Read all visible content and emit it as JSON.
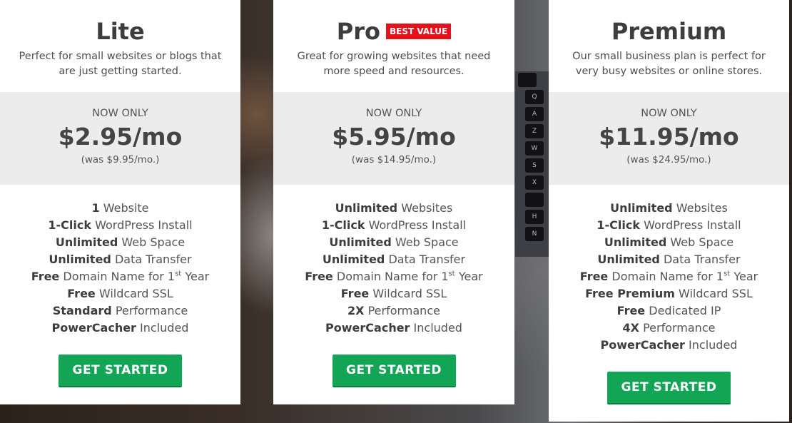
{
  "background": {
    "keyboard_keys": [
      "",
      "Q",
      "A",
      "Z",
      "W",
      "S",
      "X",
      "",
      "H",
      "N"
    ]
  },
  "colors": {
    "cta_green": "#13a556",
    "badge_red": "#e5101a",
    "price_band_gray": "#ececec"
  },
  "plans": [
    {
      "name": "Lite",
      "badge": "",
      "description": "Perfect for small websites or blogs that are just getting started.",
      "now_only": "NOW ONLY",
      "price": "$2.95/mo",
      "was": "(was $9.95/mo.)",
      "features": [
        {
          "bold": "1",
          "text": " Website"
        },
        {
          "bold": "1-Click",
          "text": " WordPress Install"
        },
        {
          "bold": "Unlimited",
          "text": " Web Space"
        },
        {
          "bold": "Unlimited",
          "text": " Data Transfer"
        },
        {
          "bold": "Free",
          "text": " Domain Name for 1",
          "sup": "st",
          "after": " Year"
        },
        {
          "bold": "Free",
          "text": " Wildcard SSL"
        },
        {
          "bold": "Standard",
          "text": " Performance"
        },
        {
          "bold": "PowerCacher",
          "text": " Included"
        }
      ],
      "cta": "GET STARTED"
    },
    {
      "name": "Pro",
      "badge": "BEST VALUE",
      "description": "Great for growing websites that need more speed and resources.",
      "now_only": "NOW ONLY",
      "price": "$5.95/mo",
      "was": "(was $14.95/mo.)",
      "features": [
        {
          "bold": "Unlimited",
          "text": " Websites"
        },
        {
          "bold": "1-Click",
          "text": " WordPress Install"
        },
        {
          "bold": "Unlimited",
          "text": " Web Space"
        },
        {
          "bold": "Unlimited",
          "text": " Data Transfer"
        },
        {
          "bold": "Free",
          "text": " Domain Name for 1",
          "sup": "st",
          "after": " Year"
        },
        {
          "bold": "Free",
          "text": " Wildcard SSL"
        },
        {
          "bold": "2X",
          "text": " Performance"
        },
        {
          "bold": "PowerCacher",
          "text": " Included"
        }
      ],
      "cta": "GET STARTED"
    },
    {
      "name": "Premium",
      "badge": "",
      "description": "Our small business plan is perfect for very busy websites or online stores.",
      "now_only": "NOW ONLY",
      "price": "$11.95/mo",
      "was": "(was $24.95/mo.)",
      "features": [
        {
          "bold": "Unlimited",
          "text": " Websites"
        },
        {
          "bold": "1-Click",
          "text": " WordPress Install"
        },
        {
          "bold": "Unlimited",
          "text": " Web Space"
        },
        {
          "bold": "Unlimited",
          "text": " Data Transfer"
        },
        {
          "bold": "Free",
          "text": " Domain Name for 1",
          "sup": "st",
          "after": " Year"
        },
        {
          "bold": "Free Premium",
          "text": " Wildcard SSL"
        },
        {
          "bold": "Free",
          "text": " Dedicated IP"
        },
        {
          "bold": "4X",
          "text": " Performance"
        },
        {
          "bold": "PowerCacher",
          "text": " Included"
        }
      ],
      "cta": "GET STARTED"
    }
  ]
}
